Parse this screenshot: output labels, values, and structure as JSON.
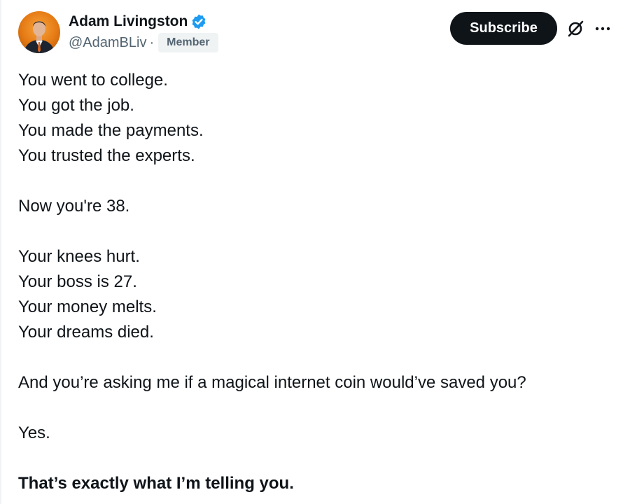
{
  "author": {
    "display_name": "Adam Livingston",
    "handle": "@AdamBLiv",
    "separator": "·",
    "badge": "Member",
    "verified_icon": "verified-badge-icon",
    "avatar_icon": "avatar-photo"
  },
  "actions": {
    "subscribe_label": "Subscribe",
    "grok_icon": "grok-icon",
    "more_icon": "more-options-icon"
  },
  "post": {
    "lines": [
      "You went to college.",
      "You got the job.",
      "You made the payments.",
      "You trusted the experts.",
      "Now you're 38.",
      "Your knees hurt.",
      "Your boss is 27.",
      "Your money melts.",
      "Your dreams died.",
      "And you’re asking me if a magical internet coin would’ve saved you?",
      "Yes.",
      "That’s exactly what I’m telling you."
    ]
  },
  "colors": {
    "text": "#0f1419",
    "secondary": "#536471",
    "verified": "#1d9bf0",
    "badge_bg": "#eff3f4",
    "button_bg": "#0f1419",
    "button_text": "#ffffff"
  }
}
